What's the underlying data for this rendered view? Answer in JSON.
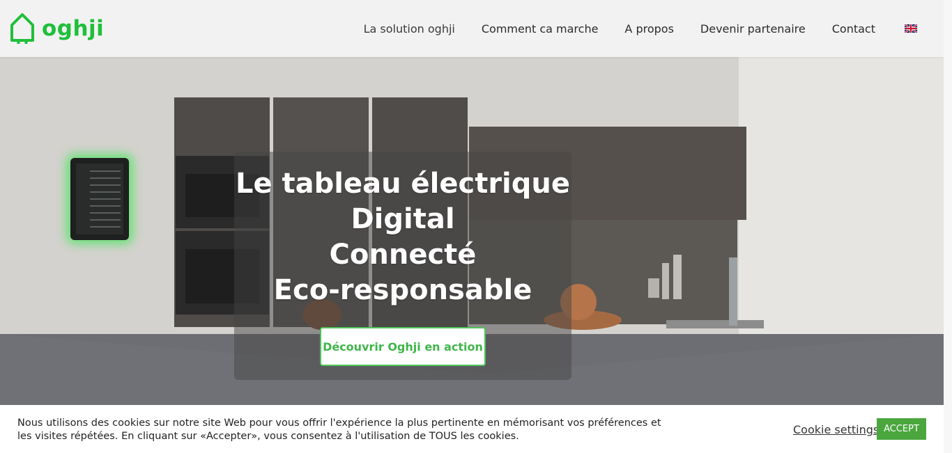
{
  "header": {
    "logo_text": "oghji",
    "nav": [
      "La solution oghji",
      "Comment ca marche",
      "A propos",
      "Devenir partenaire",
      "Contact"
    ],
    "language_flag": "uk-flag-icon"
  },
  "hero": {
    "headline": [
      "Le tableau électrique",
      "Digital",
      "Connecté",
      "Eco-responsable"
    ],
    "cta_label": "Découvrir Oghji en action"
  },
  "cookie": {
    "text": "Nous utilisons des cookies sur notre site Web pour vous offrir l'expérience la plus pertinente en mémorisant vos préférences et les visites répétées. En cliquant sur «Accepter», vous consentez à l'utilisation de TOUS les cookies.",
    "settings_label": "Cookie settings",
    "accept_label": "ACCEPT"
  },
  "colors": {
    "brand_green": "#1fbf3a",
    "accept_green": "#4aa63d",
    "cta_border": "#4fc45a"
  }
}
